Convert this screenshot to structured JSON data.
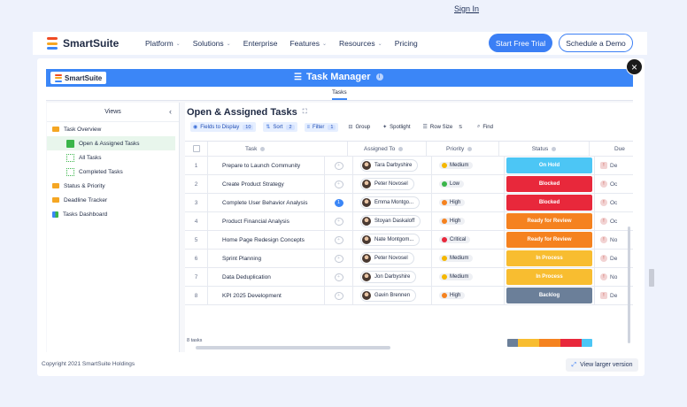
{
  "nav": {
    "brand": "SmartSuite",
    "brand_colors": [
      "#f04b23",
      "#f5a623",
      "#3b86f7"
    ],
    "links": [
      {
        "label": "Platform",
        "has_menu": true
      },
      {
        "label": "Solutions",
        "has_menu": true
      },
      {
        "label": "Enterprise",
        "has_menu": false
      },
      {
        "label": "Features",
        "has_menu": true
      },
      {
        "label": "Resources",
        "has_menu": true
      },
      {
        "label": "Pricing",
        "has_menu": false
      }
    ],
    "sign_in": "Sign In",
    "cta_primary": "Start Free Trial",
    "cta_secondary": "Schedule a Demo",
    "chevron_icon": "chevron-down-icon"
  },
  "modal": {
    "close_icon": "×",
    "copyright": "Copyright 2021 SmartSuite Holdings",
    "view_larger": "View larger version",
    "view_larger_icon": "expand-icon"
  },
  "app": {
    "logo_text": "SmartSuite",
    "title": "Task Manager",
    "title_icon": "list-icon",
    "info_icon": "i",
    "subtab": "Tasks",
    "accent": "#3b86f7"
  },
  "sidebar": {
    "header": "Views",
    "collapse_icon": "‹",
    "items": [
      {
        "label": "Task Overview",
        "type": "folder"
      },
      {
        "label": "Open & Assigned Tasks",
        "type": "view",
        "active": true
      },
      {
        "label": "All Tasks",
        "type": "view"
      },
      {
        "label": "Completed Tasks",
        "type": "view"
      },
      {
        "label": "Status & Priority",
        "type": "folder"
      },
      {
        "label": "Deadline Tracker",
        "type": "folder"
      },
      {
        "label": "Tasks Dashboard",
        "type": "dashboard"
      }
    ]
  },
  "main": {
    "title": "Open & Assigned Tasks",
    "share_icon": "share-icon",
    "toolbar": [
      {
        "label": "Fields to Display",
        "count": "10",
        "icon": "eye-icon",
        "active": true
      },
      {
        "label": "Sort",
        "count": "2",
        "icon": "sort-icon",
        "active": true
      },
      {
        "label": "Filter",
        "count": "1",
        "icon": "filter-icon",
        "active": true
      },
      {
        "label": "Group",
        "count": "",
        "icon": "group-icon",
        "active": false
      },
      {
        "label": "Spotlight",
        "count": "",
        "icon": "spotlight-icon",
        "active": false
      },
      {
        "label": "Row Size",
        "count": "S",
        "icon": "row-size-icon",
        "active": false
      },
      {
        "label": "Find",
        "count": "",
        "icon": "search-icon",
        "active": false
      }
    ],
    "columns": {
      "task": "Task",
      "assigned": "Assigned To",
      "priority": "Priority",
      "status": "Status",
      "due": "Due"
    },
    "rows": [
      {
        "num": "1",
        "task": "Prepare to Launch Community",
        "comments": "",
        "assignee": "Tara Darbyshire",
        "priority": "Medium",
        "status": "On Hold",
        "due": "De"
      },
      {
        "num": "2",
        "task": "Create Product Strategy",
        "comments": "",
        "assignee": "Peter Novosel",
        "priority": "Low",
        "status": "Blocked",
        "due": "Oc"
      },
      {
        "num": "3",
        "task": "Complete User Behavior Analysis",
        "comments": "1",
        "assignee": "Emma Montgo...",
        "priority": "High",
        "status": "Blocked",
        "due": "Oc"
      },
      {
        "num": "4",
        "task": "Product Financial Analysis",
        "comments": "",
        "assignee": "Stoyan Daskaloff",
        "priority": "High",
        "status": "Ready for Review",
        "due": "Oc"
      },
      {
        "num": "5",
        "task": "Home Page Redesign Concepts",
        "comments": "",
        "assignee": "Nate Montgom...",
        "priority": "Critical",
        "status": "Ready for Review",
        "due": "No"
      },
      {
        "num": "6",
        "task": "Sprint Planning",
        "comments": "",
        "assignee": "Peter Novosel",
        "priority": "Medium",
        "status": "In Process",
        "due": "De"
      },
      {
        "num": "7",
        "task": "Data Deduplication",
        "comments": "",
        "assignee": "Jon Darbyshire",
        "priority": "Medium",
        "status": "In Process",
        "due": "No"
      },
      {
        "num": "8",
        "task": "KPI 2025 Development",
        "comments": "",
        "assignee": "Gavin Brennen",
        "priority": "High",
        "status": "Backlog",
        "due": "De"
      }
    ],
    "task_count": "8 tasks",
    "priority_colors": {
      "Low": "#3ab54a",
      "Medium": "#f5b700",
      "High": "#f5821f",
      "Critical": "#e8283b"
    },
    "status_colors": {
      "On Hold": "#4cc6f5",
      "Blocked": "#e8283b",
      "Ready for Review": "#f5821f",
      "In Process": "#f8bd30",
      "Backlog": "#6b7f99"
    },
    "summary_segments": [
      {
        "color": "#6b7f99",
        "share": 0.125
      },
      {
        "color": "#f8bd30",
        "share": 0.25
      },
      {
        "color": "#f5821f",
        "share": 0.25
      },
      {
        "color": "#e8283b",
        "share": 0.25
      },
      {
        "color": "#4cc6f5",
        "share": 0.125
      }
    ]
  }
}
